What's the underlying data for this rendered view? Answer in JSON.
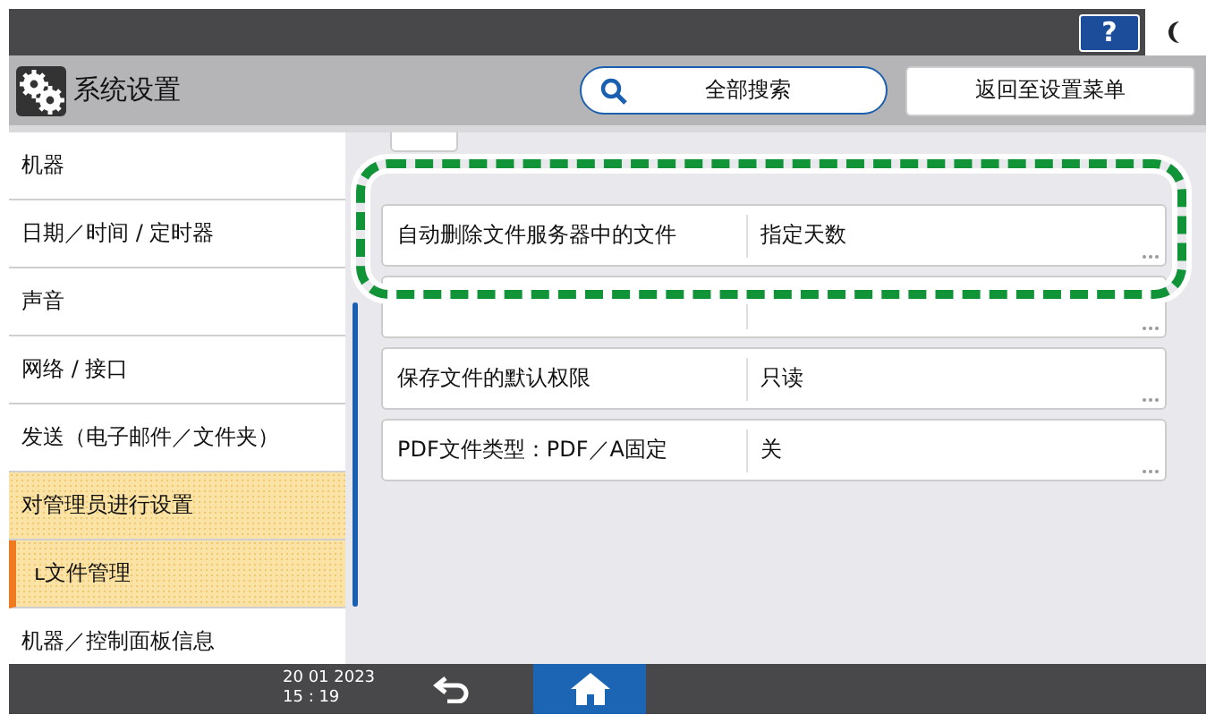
{
  "header": {
    "title": "系统设置",
    "search_button": "全部搜索",
    "back_button": "返回至设置菜单",
    "help": "?"
  },
  "sidebar": {
    "items": [
      {
        "label": "机器",
        "highlighted": false,
        "selected": false
      },
      {
        "label": "日期／时间 / 定时器",
        "highlighted": false,
        "selected": false
      },
      {
        "label": "声音",
        "highlighted": false,
        "selected": false
      },
      {
        "label": "网络 / 接口",
        "highlighted": false,
        "selected": false
      },
      {
        "label": "发送（电子邮件／文件夹）",
        "highlighted": false,
        "selected": false
      },
      {
        "label": "对管理员进行设置",
        "highlighted": true,
        "selected": false
      },
      {
        "label": "文件管理",
        "prefix": "ʟ",
        "highlighted": true,
        "selected": true
      },
      {
        "label": "机器／控制面板信息",
        "highlighted": false,
        "selected": false
      }
    ]
  },
  "settings": [
    {
      "label": "自动删除文件服务器中的文件",
      "value": "指定天数",
      "callout": true
    },
    {
      "callout": false
    },
    {
      "label": "保存文件的默认权限",
      "value": "只读",
      "callout": false
    },
    {
      "label": "PDF文件类型：PDF／A固定",
      "value": "关",
      "callout": false
    }
  ],
  "status_bar": {
    "date": "20 01 2023",
    "time": "15 : 19"
  }
}
